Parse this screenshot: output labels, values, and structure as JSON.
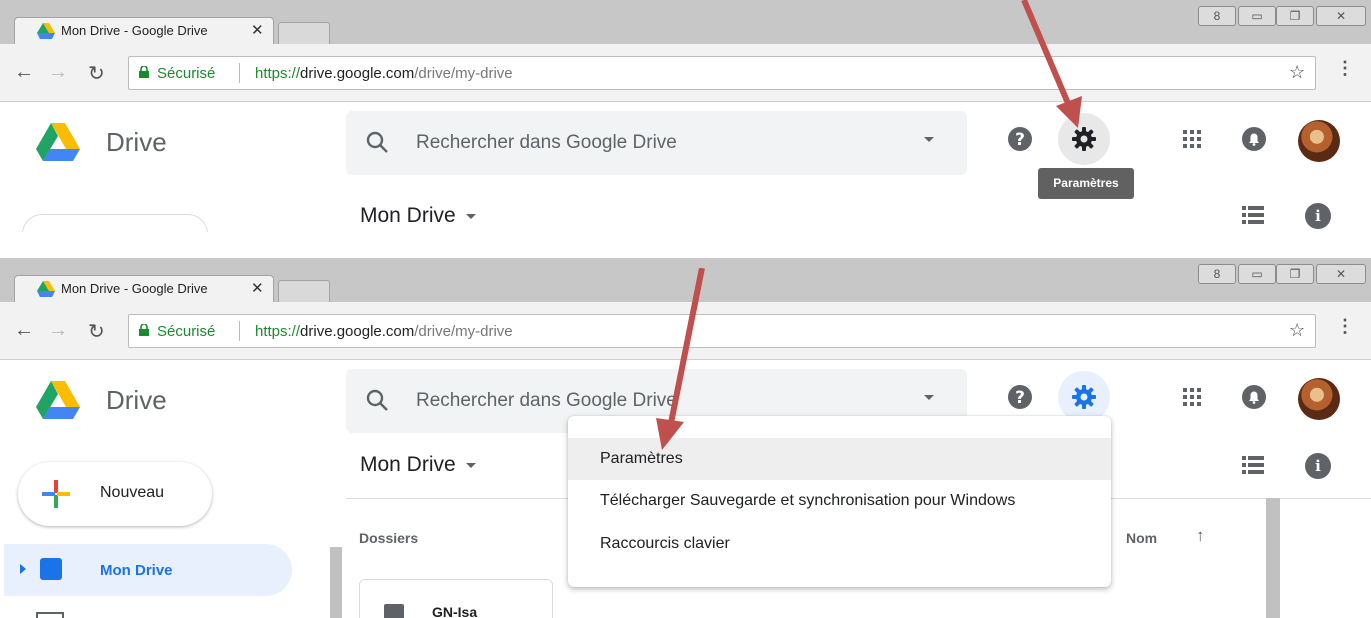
{
  "browser": {
    "tab_title": "Mon Drive - Google Drive",
    "tab_close": "✕",
    "secure_label": "Sécurisé",
    "url_scheme": "https://",
    "url_domain": "drive.google.com",
    "url_path": "/drive/my-drive"
  },
  "drive": {
    "brand": "Drive",
    "search_placeholder": "Rechercher dans Google Drive",
    "page_title": "Mon Drive",
    "settings_tooltip": "Paramètres",
    "new_button": "Nouveau",
    "sidebar_my_drive": "Mon Drive",
    "section_folders": "Dossiers",
    "sort_label": "Nom",
    "sort_icon": "↑",
    "folder_name": "GN-Isa"
  },
  "settings_menu": {
    "items": [
      "Paramètres",
      "Télécharger Sauvegarde et synchronisation pour Windows",
      "Raccourcis clavier"
    ]
  },
  "colors": {
    "accent": "#1a73e8",
    "secure_green": "#1b8a2f",
    "annotation_arrow": "#c0504d"
  }
}
